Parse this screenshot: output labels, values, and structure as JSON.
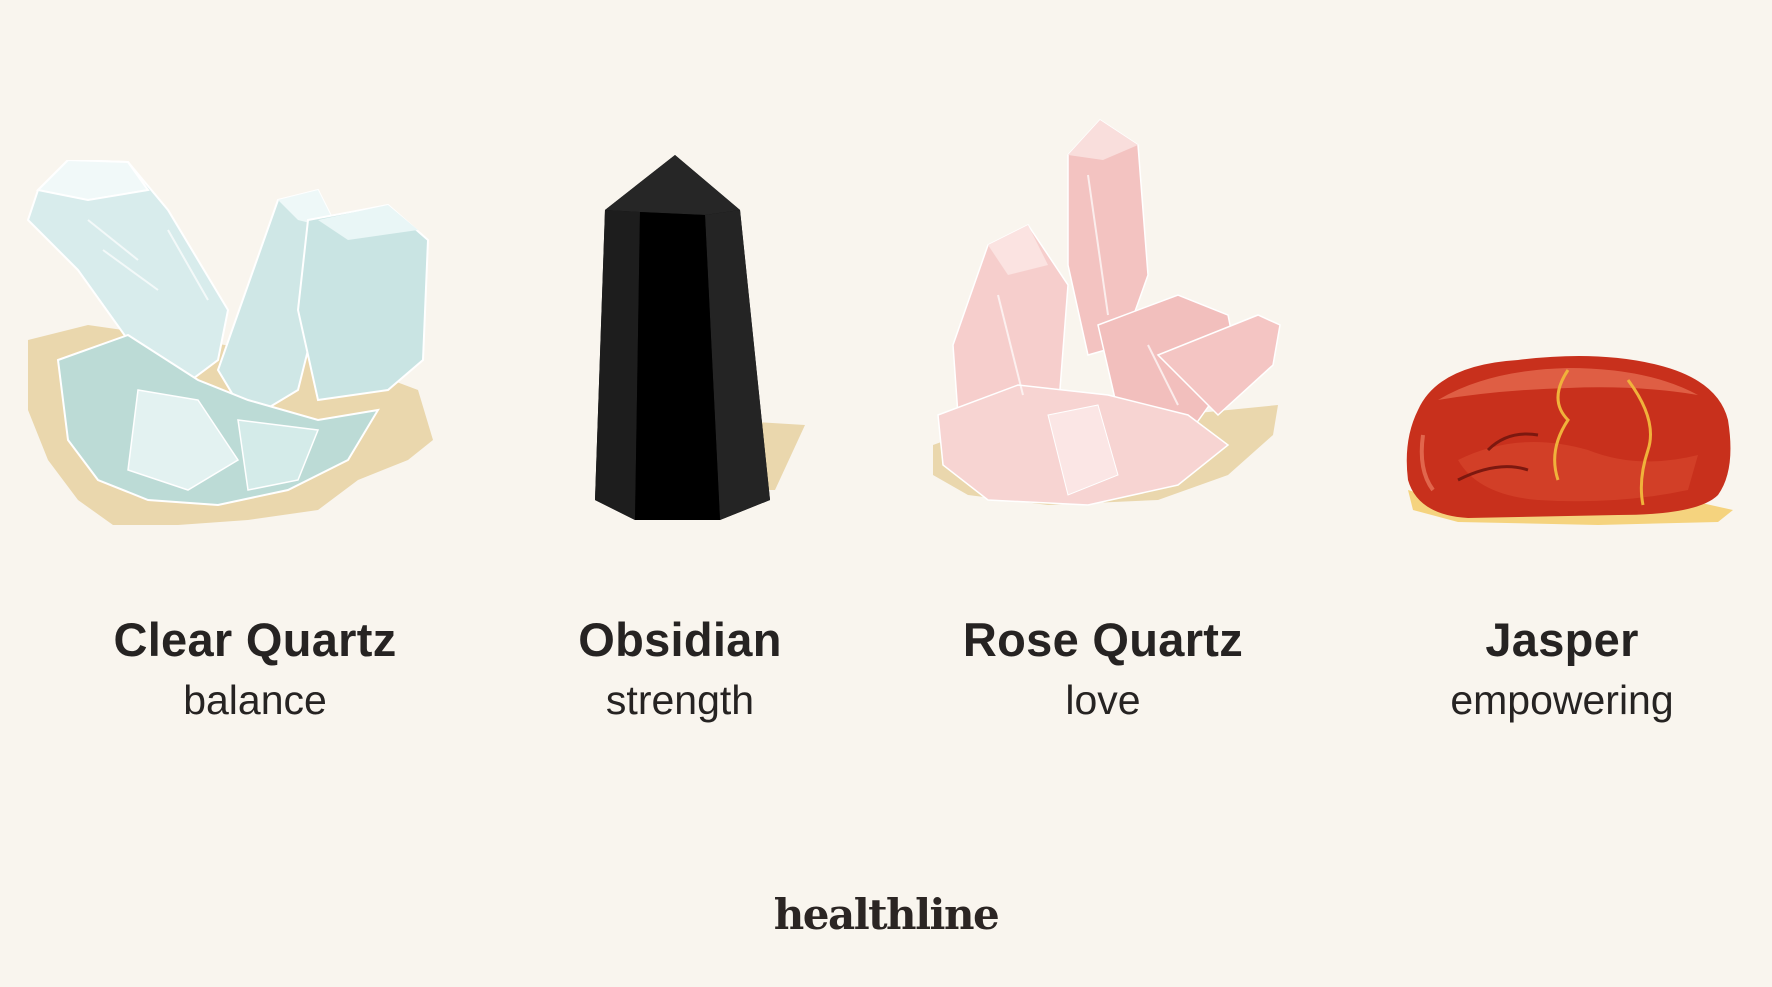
{
  "items": [
    {
      "name": "Clear Quartz",
      "trait": "balance",
      "icon": "clear-quartz-crystal-icon"
    },
    {
      "name": "Obsidian",
      "trait": "strength",
      "icon": "obsidian-crystal-icon"
    },
    {
      "name": "Rose Quartz",
      "trait": "love",
      "icon": "rose-quartz-crystal-icon"
    },
    {
      "name": "Jasper",
      "trait": "empowering",
      "icon": "jasper-stone-icon"
    }
  ],
  "brand": {
    "logo_text": "healthline"
  },
  "colors": {
    "background": "#f9f5ee",
    "shadow": "#ead7ad",
    "clear_quartz": "#d6ecec",
    "obsidian": "#0a0a0a",
    "rose_quartz": "#f5c9c6",
    "jasper": "#c22c1a",
    "text": "#262322"
  }
}
